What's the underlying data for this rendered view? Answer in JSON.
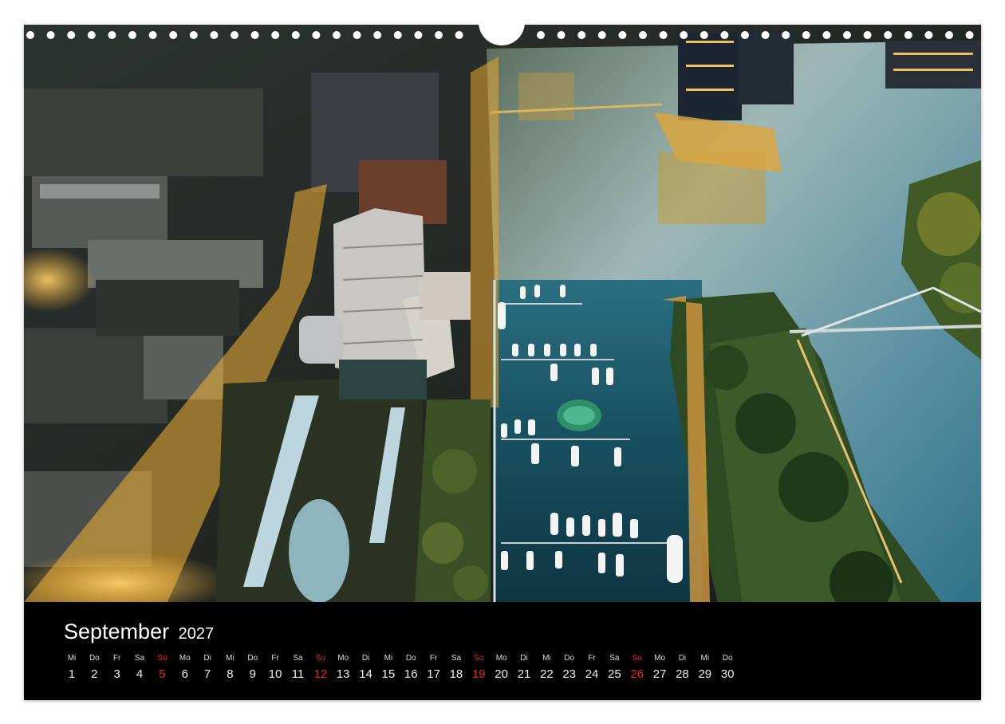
{
  "calendar": {
    "month": "September",
    "year": "2027",
    "days": [
      {
        "wd": "Mi",
        "n": "1"
      },
      {
        "wd": "Do",
        "n": "2"
      },
      {
        "wd": "Fr",
        "n": "3"
      },
      {
        "wd": "Sa",
        "n": "4"
      },
      {
        "wd": "So",
        "n": "5",
        "sunday": true
      },
      {
        "wd": "Mo",
        "n": "6"
      },
      {
        "wd": "Di",
        "n": "7"
      },
      {
        "wd": "Mi",
        "n": "8"
      },
      {
        "wd": "Do",
        "n": "9"
      },
      {
        "wd": "Fr",
        "n": "10"
      },
      {
        "wd": "Sa",
        "n": "11"
      },
      {
        "wd": "So",
        "n": "12",
        "sunday": true
      },
      {
        "wd": "Mo",
        "n": "13"
      },
      {
        "wd": "Di",
        "n": "14"
      },
      {
        "wd": "Mi",
        "n": "15"
      },
      {
        "wd": "Do",
        "n": "16"
      },
      {
        "wd": "Fr",
        "n": "17"
      },
      {
        "wd": "Sa",
        "n": "18"
      },
      {
        "wd": "So",
        "n": "19",
        "sunday": true
      },
      {
        "wd": "Mo",
        "n": "20"
      },
      {
        "wd": "Di",
        "n": "21"
      },
      {
        "wd": "Mi",
        "n": "22"
      },
      {
        "wd": "Do",
        "n": "23"
      },
      {
        "wd": "Fr",
        "n": "24"
      },
      {
        "wd": "Sa",
        "n": "25"
      },
      {
        "wd": "So",
        "n": "26",
        "sunday": true
      },
      {
        "wd": "Mo",
        "n": "27"
      },
      {
        "wd": "Di",
        "n": "28"
      },
      {
        "wd": "Mi",
        "n": "29"
      },
      {
        "wd": "Do",
        "n": "30"
      }
    ]
  },
  "colors": {
    "sunday": "#e0282a",
    "background": "#000000",
    "water": "#1d5f74",
    "city_lights": "#f2b233"
  }
}
